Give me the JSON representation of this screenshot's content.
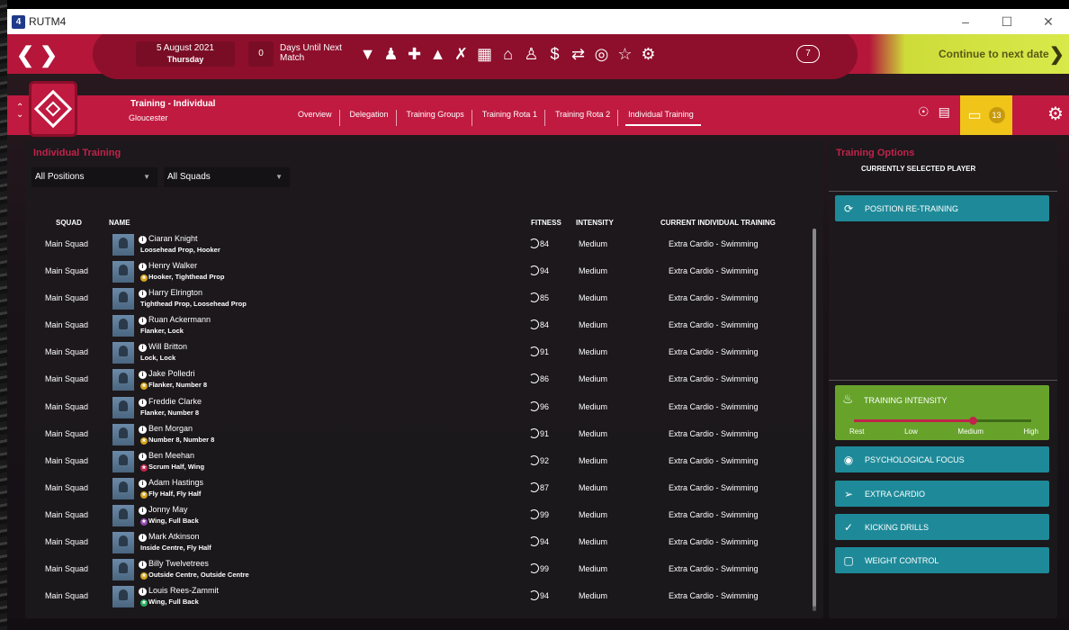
{
  "window": {
    "app_number": "4",
    "title": "RUTM4",
    "minimize": "–",
    "maximize": "☐",
    "close": "✕"
  },
  "topbar": {
    "date": "5 August 2021",
    "weekday": "Thursday",
    "days_until": "0",
    "days_label": "Days Until Next Match",
    "notifications": "7",
    "continue_label": "Continue to next date",
    "icons": [
      "shield-icon",
      "people-icon",
      "medical-icon",
      "cone-icon",
      "tactics-icon",
      "calendar-icon",
      "home-icon",
      "group-icon",
      "finance-icon",
      "transfer-icon",
      "target-icon",
      "trophy-icon",
      "staff-icon"
    ]
  },
  "header": {
    "title": "Training - Individual",
    "subtitle": "Gloucester",
    "tabs": [
      "Overview",
      "Delegation",
      "Training Groups",
      "Training Rota 1",
      "Training Rota 2",
      "Individual Training"
    ],
    "active_tab": "Individual Training",
    "inbox_count": "13"
  },
  "main": {
    "title": "Individual Training",
    "filter_positions": "All Positions",
    "filter_squads": "All Squads",
    "columns": {
      "squad": "SQUAD",
      "name": "NAME",
      "fitness": "FITNESS",
      "intensity": "INTENSITY",
      "training": "CURRENT INDIVIDUAL TRAINING"
    },
    "players": [
      {
        "squad": "Main Squad",
        "name": "Ciaran Knight",
        "positions": "Loosehead Prop, Hooker",
        "star": "",
        "fitness": "84",
        "intensity": "Medium",
        "training": "Extra Cardio - Swimming"
      },
      {
        "squad": "Main Squad",
        "name": "Henry Walker",
        "positions": "Hooker, Tighthead Prop",
        "star": "gold",
        "fitness": "94",
        "intensity": "Medium",
        "training": "Extra Cardio - Swimming"
      },
      {
        "squad": "Main Squad",
        "name": "Harry Elrington",
        "positions": "Tighthead Prop, Loosehead Prop",
        "star": "",
        "fitness": "85",
        "intensity": "Medium",
        "training": "Extra Cardio - Swimming"
      },
      {
        "squad": "Main Squad",
        "name": "Ruan Ackermann",
        "positions": "Flanker, Lock",
        "star": "",
        "fitness": "84",
        "intensity": "Medium",
        "training": "Extra Cardio - Swimming"
      },
      {
        "squad": "Main Squad",
        "name": "Will Britton",
        "positions": "Lock, Lock",
        "star": "",
        "fitness": "91",
        "intensity": "Medium",
        "training": "Extra Cardio - Swimming"
      },
      {
        "squad": "Main Squad",
        "name": "Jake Polledri",
        "positions": "Flanker, Number 8",
        "star": "gold",
        "fitness": "86",
        "intensity": "Medium",
        "training": "Extra Cardio - Swimming"
      },
      {
        "squad": "Main Squad",
        "name": "Freddie Clarke",
        "positions": "Flanker, Number 8",
        "star": "",
        "fitness": "96",
        "intensity": "Medium",
        "training": "Extra Cardio - Swimming"
      },
      {
        "squad": "Main Squad",
        "name": "Ben Morgan",
        "positions": "Number 8, Number 8",
        "star": "gold",
        "fitness": "91",
        "intensity": "Medium",
        "training": "Extra Cardio - Swimming"
      },
      {
        "squad": "Main Squad",
        "name": "Ben Meehan",
        "positions": "Scrum Half, Wing",
        "star": "red",
        "fitness": "92",
        "intensity": "Medium",
        "training": "Extra Cardio - Swimming"
      },
      {
        "squad": "Main Squad",
        "name": "Adam Hastings",
        "positions": "Fly Half, Fly Half",
        "star": "gold",
        "fitness": "87",
        "intensity": "Medium",
        "training": "Extra Cardio - Swimming"
      },
      {
        "squad": "Main Squad",
        "name": "Jonny May",
        "positions": "Wing, Full Back",
        "star": "purple",
        "fitness": "99",
        "intensity": "Medium",
        "training": "Extra Cardio - Swimming"
      },
      {
        "squad": "Main Squad",
        "name": "Mark Atkinson",
        "positions": "Inside Centre, Fly Half",
        "star": "",
        "fitness": "94",
        "intensity": "Medium",
        "training": "Extra Cardio - Swimming"
      },
      {
        "squad": "Main Squad",
        "name": "Billy Twelvetrees",
        "positions": "Outside Centre, Outside Centre",
        "star": "gold",
        "fitness": "99",
        "intensity": "Medium",
        "training": "Extra Cardio - Swimming"
      },
      {
        "squad": "Main Squad",
        "name": "Louis Rees-Zammit",
        "positions": "Wing, Full Back",
        "star": "green",
        "fitness": "94",
        "intensity": "Medium",
        "training": "Extra Cardio - Swimming"
      }
    ]
  },
  "options": {
    "title": "Training Options",
    "subtitle": "CURRENTLY SELECTED PLAYER",
    "position_retraining": "POSITION RE-TRAINING",
    "training_intensity": "TRAINING INTENSITY",
    "intensity_marks": [
      "Rest",
      "Low",
      "Medium",
      "High"
    ],
    "intensity_level": "Medium",
    "psychological_focus": "PSYCHOLOGICAL FOCUS",
    "extra_cardio": "EXTRA CARDIO",
    "kicking_drills": "KICKING DRILLS",
    "weight_control": "WEIGHT CONTROL"
  },
  "colors": {
    "brand_red": "#c01a40",
    "accent_yellow": "#d8e94a",
    "teal": "#1e8a99",
    "green": "#67a32b"
  }
}
